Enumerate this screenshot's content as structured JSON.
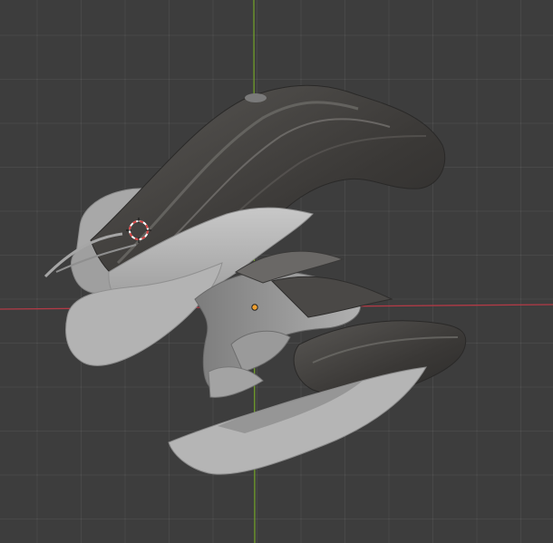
{
  "viewport": {
    "background_color": "#3d3d3d",
    "grid_color": "#4a4a4a",
    "x_axis_color": "#b23a46",
    "y_axis_color": "#6f9d2a",
    "mesh_light": "#b9b9b9",
    "mesh_mid": "#8a8a8a",
    "mesh_dark": "#3c3a38",
    "cursor_colors": [
      "#d84444",
      "#ffffff"
    ],
    "origin_color": "#f0a030"
  }
}
